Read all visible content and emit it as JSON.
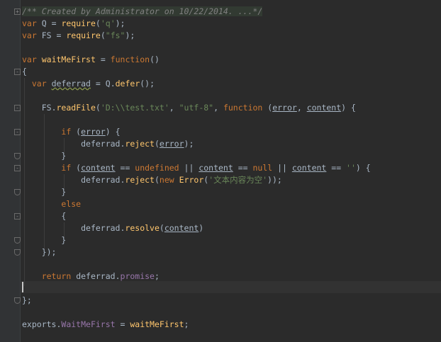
{
  "code": {
    "comment": "/** Created by Administrator on 10/22/2014. ...*/",
    "kw_var": "var",
    "kw_function": "function",
    "kw_if": "if",
    "kw_else": "else",
    "kw_return": "return",
    "kw_new": "new",
    "kw_null": "null",
    "q": "Q",
    "fs": "FS",
    "eq": " = ",
    "require": "require",
    "str_q": "'q'",
    "str_fs": "\"fs\"",
    "wait_me_first": "waitMeFirst",
    "open_brace": "{",
    "deferrad": "deferrad",
    "defer": "defer",
    "read_file": "readFile",
    "str_path": "'D:\\\\test.txt'",
    "str_utf8": "\"utf-8\"",
    "error": "error",
    "content": "content",
    "reject": "reject",
    "undefined": "undefined",
    "str_empty": "''",
    "error_class": "Error",
    "str_error_msg": "'文本内容为空'",
    "resolve": "resolve",
    "promise": "promise",
    "close_semicolon": "};",
    "exports": "exports",
    "exports_prop": "WaitMeFirst"
  }
}
